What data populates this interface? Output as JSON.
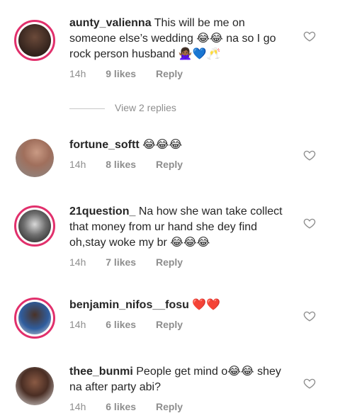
{
  "comments": [
    {
      "username": "aunty_valienna",
      "text": "This will be me on someone else’s wedding 😂😂 na so I go rock person husband 🙅🏾‍♀️💙🥂",
      "time": "14h",
      "likes": "9 likes",
      "reply": "Reply",
      "view_replies": "View 2 replies"
    },
    {
      "username": "fortune_softt",
      "text": "😂😂😂",
      "time": "14h",
      "likes": "8 likes",
      "reply": "Reply"
    },
    {
      "username": "21question_",
      "text": "Na how she wan take collect that money from ur hand she dey find oh,stay woke my br 😂😂😂",
      "time": "14h",
      "likes": "7 likes",
      "reply": "Reply"
    },
    {
      "username": "benjamin_nifos__fosu",
      "text": "❤️❤️",
      "time": "14h",
      "likes": "6 likes",
      "reply": "Reply"
    },
    {
      "username": "thee_bunmi",
      "text": "People get mind o😂😂 shey na after party abi?",
      "time": "14h",
      "likes": "6 likes",
      "reply": "Reply"
    }
  ],
  "colors": {
    "story_ring": "#e1306c",
    "meta_text": "#8e8e8e",
    "heart_outline": "#8e8e8e"
  },
  "icons": {
    "like": "heart-outline-icon"
  }
}
